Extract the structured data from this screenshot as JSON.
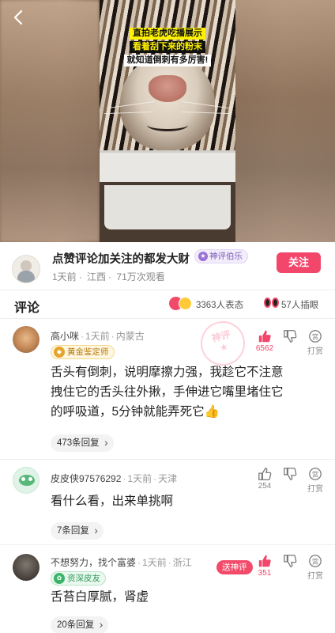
{
  "video": {
    "captions": [
      "直拍老虎吃播展示",
      "看着刮下来的粉末",
      "就知道倒刺有多厉害!"
    ]
  },
  "author": {
    "title": "点赞评论加关注的都发大财",
    "badge": "神评伯乐",
    "meta": [
      "1天前",
      "·",
      "江西",
      "·",
      "71万次观看"
    ],
    "follow_label": "关注"
  },
  "comments_header": {
    "label": "评论",
    "reactions": "3363人表态",
    "peeks": "57人插眼"
  },
  "comments": [
    {
      "user": "高小咪",
      "time": "1天前",
      "region": "内蒙古",
      "badge": "黄金鉴定师",
      "text": "舌头有倒刺，说明摩擦力强，我趁它不注意拽住它的舌头往外揪，手伸进它嘴里堵住它的呼吸道，5分钟就能弄死它👍",
      "replies": "473条回复",
      "likes": "6562",
      "dislike_label": "",
      "reward_label": "打赏",
      "stamp": "神评"
    },
    {
      "user": "皮皮侠97576292",
      "time": "1天前",
      "region": "天津",
      "text": "看什么看，出来单挑啊",
      "replies": "7条回复",
      "likes": "254",
      "reward_label": "打赏"
    },
    {
      "user": "不想努力，找个富婆",
      "time": "1天前",
      "region": "浙江",
      "badge": "资深皮友",
      "push_label": "送神评",
      "text": "舌苔白厚腻，肾虚",
      "replies": "20条回复",
      "likes": "351",
      "reward_label": "打赏"
    }
  ],
  "colors": {
    "accent": "#f2466b",
    "caption_yellow": "#fff200",
    "gold_badge": "#e4a52c",
    "green_badge": "#3bb56a",
    "purple_badge": "#9a72d6"
  }
}
